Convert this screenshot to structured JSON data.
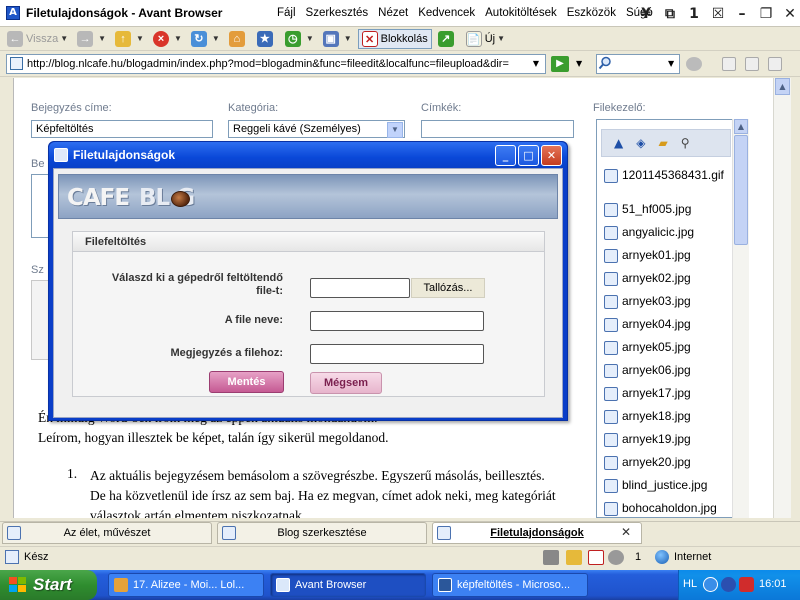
{
  "window": {
    "title": "Filetulajdonságok - Avant Browser",
    "menu": [
      "Fájl",
      "Szerkesztés",
      "Nézet",
      "Kedvencek",
      "Autokitöltések",
      "Eszközök",
      "Súgó"
    ]
  },
  "toolbar": {
    "back_label": "Vissza",
    "popup_block_label": "Blokkolás",
    "new_label": "Új"
  },
  "address": {
    "url": "http://blog.nlcafe.hu/blogadmin/index.php?mod=blogadmin&func=fileedit&localfunc=fileupload&dir="
  },
  "form": {
    "title_label": "Bejegyzés címe:",
    "title_value": "Képfeltöltés",
    "category_label": "Kategória:",
    "category_value": "Reggeli kávé (Személyes)",
    "tags_label": "Címkék:",
    "tags_value": "",
    "partial_label_1": "Be",
    "partial_label_2": "Sz"
  },
  "editor": {
    "paragraph1_line1": "Én mindig Word-ben írom meg az éppen aktuális mondandóm.",
    "paragraph1_line2": "Leírom, hogyan illesztek be képet, talán így sikerül megoldanod.",
    "list_number": "1.",
    "list_text": "Az aktuális bejegyzésem bemásolom a szövegrészbe. Egyszerű másolás, beillesztés. De ha közvetlenül ide írsz az sem baj. Ha ez megvan, címet adok neki, meg kategóriát választok artán elmentem piszkozatnak."
  },
  "filemanager": {
    "label": "Filekezelő:",
    "files": [
      "1201145368431.gif",
      "51_hf005.jpg",
      "angyalicic.jpg",
      "arnyek01.jpg",
      "arnyek02.jpg",
      "arnyek03.jpg",
      "arnyek04.jpg",
      "arnyek05.jpg",
      "arnyek06.jpg",
      "arnyek17.jpg",
      "arnyek18.jpg",
      "arnyek19.jpg",
      "arnyek20.jpg",
      "blind_justice.jpg",
      "bohocaholdon.jpg"
    ]
  },
  "dialog": {
    "title": "Filetulajdonságok",
    "logo_cafe": "CAFE",
    "logo_blog": "BL G",
    "section_title": "Filefeltöltés",
    "choose_file_label_line1": "Válaszd ki a gépedről feltöltendő",
    "choose_file_label_line2": "file-t:",
    "browse_label": "Tallózás...",
    "filename_label": "A file neve:",
    "filename_value": "",
    "comment_label": "Megjegyzés a filehoz:",
    "comment_value": "",
    "save_label": "Mentés",
    "cancel_label": "Mégsem"
  },
  "tabs": [
    {
      "label": "Az élet, művészet",
      "active": false
    },
    {
      "label": "Blog szerkesztése",
      "active": false
    },
    {
      "label": "Filetulajdonságok",
      "active": true
    }
  ],
  "status": {
    "text": "Kész",
    "count": "1",
    "zone": "Internet"
  },
  "taskbar": {
    "start_label": "Start",
    "tasks": [
      "17. Alizee - Moi... Lol...",
      "Avant Browser",
      "képfeltöltés - Microso..."
    ],
    "lang": "HL",
    "time": "16:01"
  },
  "colors": {
    "xp_blue": "#245edb",
    "start_green": "#2f8d2f",
    "dialog_blue": "#0a48d8",
    "save_pink": "#c55a93",
    "cancel_pink": "#e7b4cc"
  }
}
